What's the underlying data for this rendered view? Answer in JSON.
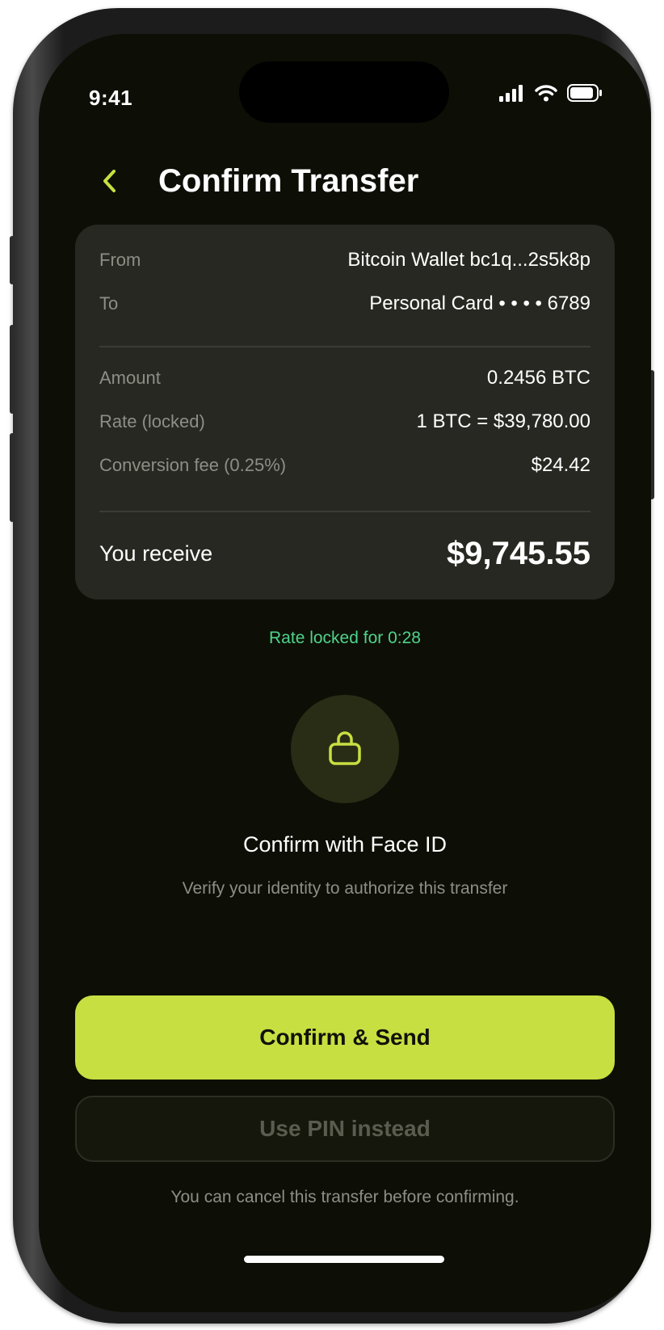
{
  "status_bar": {
    "time": "9:41",
    "signal_icon": "cellular-signal-icon",
    "wifi_icon": "wifi-icon",
    "battery_icon": "battery-icon"
  },
  "header": {
    "back_icon": "chevron-left-icon",
    "title": "Confirm Transfer"
  },
  "summary": {
    "from_label": "From",
    "from_value": "Bitcoin Wallet bc1q...2s5k8p",
    "to_label": "To",
    "to_value": "Personal Card • • • • 6789",
    "amount_label": "Amount",
    "amount_value": "0.2456 BTC",
    "rate_label": "Rate (locked)",
    "rate_value": "1 BTC = $39,780.00",
    "fee_label": "Conversion fee (0.25%)",
    "fee_value": "$24.42",
    "receive_label": "You receive",
    "receive_value": "$9,745.55"
  },
  "rate_lock_text": "Rate locked for 0:28",
  "auth": {
    "icon": "lock-icon",
    "title": "Confirm with Face ID",
    "subtitle": "Verify your identity to authorize this transfer"
  },
  "actions": {
    "confirm_label": "Confirm & Send",
    "pin_label": "Use PIN instead"
  },
  "footnote": "You can cancel this transfer before confirming.",
  "colors": {
    "accent": "#c8df42",
    "background": "#0d0f06",
    "card": "#272821",
    "success": "#4fd38a",
    "muted_text": "#8d8e86"
  }
}
